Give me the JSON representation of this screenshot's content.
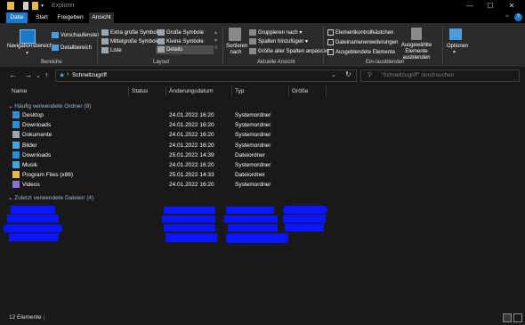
{
  "window": {
    "title": "Explorer"
  },
  "ribbon": {
    "tabs": [
      "Datei",
      "Start",
      "Freigeben",
      "Ansicht"
    ],
    "panes": {
      "navigation_pane": "Navigationsbereich",
      "preview_pane": "Vorschaufenster",
      "details_pane": "Detailbereich",
      "group_label": "Bereiche"
    },
    "layout": {
      "options": [
        "Extra große Symbole",
        "Große Symbole",
        "Mittelgroße Symbole",
        "Kleine Symbole",
        "Liste",
        "Details"
      ],
      "selected": "Details",
      "group_label": "Layout"
    },
    "current_view": {
      "sort_label": "Sortieren nach",
      "group_by": "Gruppieren nach",
      "add_columns": "Spalten hinzufügen",
      "size_all_columns": "Größe aller Spalten anpassen",
      "group_label": "Aktuelle Ansicht"
    },
    "show_hide": {
      "item_checkboxes": "Elementkontrollkästchen",
      "file_extensions": "Dateinamenerweiterungen",
      "hidden_items": "Ausgeblendete Elemente",
      "hide_selected": "Ausgewählte Elemente ausblenden",
      "group_label": "Ein-/ausblenden"
    },
    "options_label": "Optionen"
  },
  "address": {
    "path": "Schnellzugriff"
  },
  "search": {
    "placeholder": "\"Schnellzugriff\" durchsuchen"
  },
  "columns": {
    "name": "Name",
    "status": "Status",
    "date": "Änderungsdatum",
    "type": "Typ",
    "size": "Größe"
  },
  "groups": {
    "frequent": {
      "title": "Häufig verwendete Ordner (8)",
      "items": [
        {
          "name": "Desktop",
          "date": "24.01.2022 16:20",
          "type": "Systemordner",
          "icon": "desktop-folder-icon",
          "color": "#2b8fd8"
        },
        {
          "name": "Downloads",
          "date": "24.01.2022 16:20",
          "type": "Systemordner",
          "icon": "download-icon",
          "color": "#2b8fd8"
        },
        {
          "name": "Dokumente",
          "date": "24.01.2022 16:20",
          "type": "Systemordner",
          "icon": "documents-icon",
          "color": "#9aa6b2"
        },
        {
          "name": "Bilder",
          "date": "24.01.2022 16:20",
          "type": "Systemordner",
          "icon": "pictures-icon",
          "color": "#3fa7e0"
        },
        {
          "name": "Downloads",
          "date": "25.01.2022 14:39",
          "type": "Dateiordner",
          "icon": "download-icon",
          "color": "#2b8fd8"
        },
        {
          "name": "Musik",
          "date": "24.01.2022 16:20",
          "type": "Systemordner",
          "icon": "music-icon",
          "color": "#3fa7e0"
        },
        {
          "name": "Program Files (x86)",
          "date": "25.01.2022 14:33",
          "type": "Dateiordner",
          "icon": "folder-icon",
          "color": "#e6b94a"
        },
        {
          "name": "Videos",
          "date": "24.01.2022 16:20",
          "type": "Systemordner",
          "icon": "videos-icon",
          "color": "#8a6fd6"
        }
      ]
    },
    "recent": {
      "title": "Zuletzt verwendete Dateien (4)"
    }
  },
  "status": {
    "count": "12 Elemente"
  },
  "colors": {
    "accent": "#1979ca",
    "background": "#191919",
    "ribbon": "#2b2b2b",
    "redaction": "#0a14ff"
  }
}
